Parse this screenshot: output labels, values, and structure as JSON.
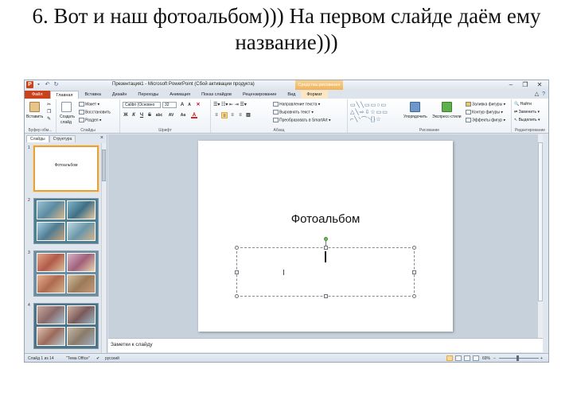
{
  "caption": {
    "line1": "6. Вот и наш фотоальбом)))  На первом слайде даём ему",
    "line2": "название)))"
  },
  "window": {
    "title": "Презентация1 - Microsoft PowerPoint (Сбой активации продукта)",
    "context_group": "Средства рисования",
    "controls": {
      "minimize": "–",
      "maximize": "❐",
      "close": "✕"
    }
  },
  "qat": {
    "logo": "P",
    "save": "▪",
    "undo": "↶",
    "redo": "↻"
  },
  "tabs": [
    {
      "label": "Файл"
    },
    {
      "label": "Главная"
    },
    {
      "label": "Вставка"
    },
    {
      "label": "Дизайн"
    },
    {
      "label": "Переходы"
    },
    {
      "label": "Анимация"
    },
    {
      "label": "Показ слайдов"
    },
    {
      "label": "Рецензирование"
    },
    {
      "label": "Вид"
    },
    {
      "label": "Формат"
    }
  ],
  "tabs_right": {
    "minimize_ribbon": "△",
    "help": "?"
  },
  "ribbon": {
    "clipboard": {
      "paste": "Вставить",
      "label": "Буфер обм..."
    },
    "slides": {
      "create": "Создать",
      "create2": "слайд",
      "layout": "Макет",
      "reset": "Восстановить",
      "section": "Раздел",
      "label": "Слайды"
    },
    "font": {
      "name": "Calibri (Основно",
      "size": "32",
      "bold": "Ж",
      "italic": "К",
      "underline": "Ч",
      "strike": "S",
      "shadow": "abc",
      "spacing": "AV",
      "case": "Aa",
      "grow": "A",
      "shrink": "A",
      "color": "A",
      "label": "Шрифт"
    },
    "paragraph": {
      "direction": "Направление текста",
      "align": "Выровнять текст",
      "smartart": "Преобразовать в SmartArt",
      "label": "Абзац"
    },
    "drawing": {
      "shapes": "▭╲╲▭▭○▭\n△╲⇨⇩☆▭▭\n⌐╲◝⌒◝{}☆",
      "arrange": "Упорядочить",
      "styles": "Экспресс-стили",
      "fill": "Заливка фигуры",
      "outline": "Контур фигуры",
      "effects": "Эффекты фигур",
      "label": "Рисование"
    },
    "editing": {
      "find": "Найти",
      "replace": "Заменить",
      "select": "Выделить",
      "label": "Редактирование"
    }
  },
  "left_panel": {
    "tabs": [
      "Слайды",
      "Структура"
    ],
    "close": "×",
    "thumbnails": [
      {
        "number": "1",
        "title": "Фотоальбом"
      },
      {
        "number": "2"
      },
      {
        "number": "3"
      },
      {
        "number": "4"
      }
    ]
  },
  "slide": {
    "title": "Фотоальбом",
    "ibeam": "I"
  },
  "notes": {
    "placeholder": "Заметки к слайду"
  },
  "status": {
    "slide_info": "Слайд 1 из 14",
    "theme": "\"Тема Office\"",
    "language": "русский",
    "zoom": "69%"
  },
  "colors": {
    "file_tab": "#c9421b",
    "selection": "#e2a242",
    "rotate_handle": "#6bc04b"
  }
}
